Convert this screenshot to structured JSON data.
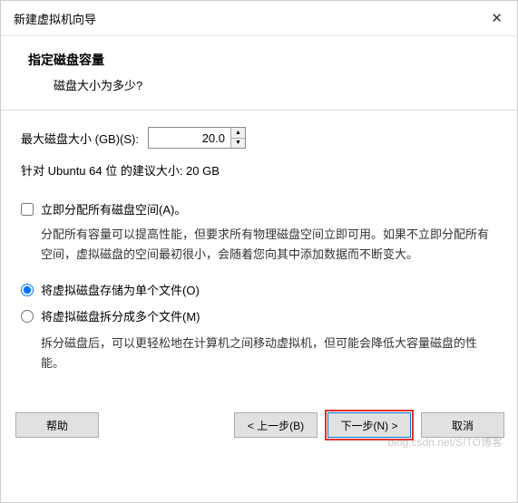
{
  "titlebar": {
    "title": "新建虚拟机向导",
    "close": "✕"
  },
  "header": {
    "heading": "指定磁盘容量",
    "sub": "磁盘大小为多少?"
  },
  "disk": {
    "label": "最大磁盘大小 (GB)(S):",
    "value": "20.0",
    "recommend": "针对 Ubuntu 64 位 的建议大小: 20 GB"
  },
  "allocate": {
    "label": "立即分配所有磁盘空间(A)。",
    "desc": "分配所有容量可以提高性能，但要求所有物理磁盘空间立即可用。如果不立即分配所有空间，虚拟磁盘的空间最初很小，会随着您向其中添加数据而不断变大。"
  },
  "storage": {
    "single": "将虚拟磁盘存储为单个文件(O)",
    "split": "将虚拟磁盘拆分成多个文件(M)",
    "split_desc": "拆分磁盘后，可以更轻松地在计算机之间移动虚拟机，但可能会降低大容量磁盘的性能。"
  },
  "buttons": {
    "help": "帮助",
    "back": "< 上一步(B)",
    "next": "下一步(N) >",
    "cancel": "取消"
  },
  "watermark": "blog.csdn.net/SITO博客"
}
